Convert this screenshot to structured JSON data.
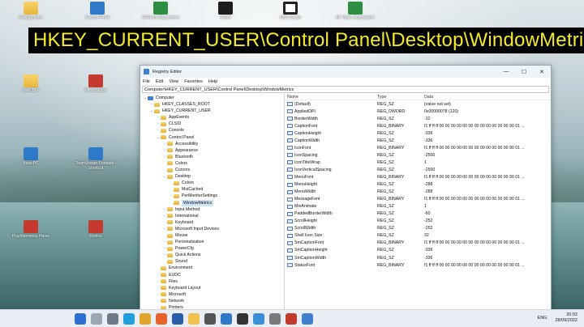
{
  "banner_text": "HKEY_CURRENT_USER\\Control Panel\\Desktop\\WindowMetrics",
  "desktop_icons": [
    {
      "label": "Desktop Icon",
      "glyph": "folder-glyph"
    },
    {
      "label": "Control Panel",
      "glyph": "app-glyph-blue"
    },
    {
      "label": "GeForce Experience",
      "glyph": "app-glyph-green"
    },
    {
      "label": "DS4S",
      "glyph": "app-glyph-dark"
    },
    {
      "label": "OBS Studio",
      "glyph": "app-glyph-round"
    },
    {
      "label": "4K Video Downloader",
      "glyph": "app-glyph-green"
    },
    {
      "label": "newCBFF",
      "glyph": "folder-glyph"
    },
    {
      "label": "PhotoScape",
      "glyph": "app-glyph-red"
    },
    {
      "label": "BasicPC",
      "glyph": "app-glyph-blue"
    },
    {
      "label": "TeamViewer Portable - Shortcut",
      "glyph": "app-glyph-blue"
    },
    {
      "label": "PlayMemories Home",
      "glyph": "app-glyph-red"
    },
    {
      "label": "Firefox",
      "glyph": "app-glyph-red"
    }
  ],
  "window": {
    "title": "Registry Editor",
    "buttons": {
      "minimize": "—",
      "maximize": "☐",
      "close": "✕"
    },
    "menu": [
      "File",
      "Edit",
      "View",
      "Favorites",
      "Help"
    ],
    "address": "Computer\\HKEY_CURRENT_USER\\Control Panel\\Desktop\\WindowMetrics"
  },
  "tree": [
    {
      "label": "Computer",
      "depth": 0,
      "arrow": "⌄",
      "icon": "pc"
    },
    {
      "label": "HKEY_CLASSES_ROOT",
      "depth": 1,
      "arrow": "›",
      "icon": "folder"
    },
    {
      "label": "HKEY_CURRENT_USER",
      "depth": 1,
      "arrow": "⌄",
      "icon": "folder"
    },
    {
      "label": "AppEvents",
      "depth": 2,
      "arrow": "›",
      "icon": "folder"
    },
    {
      "label": "CLSID",
      "depth": 2,
      "arrow": "›",
      "icon": "folder"
    },
    {
      "label": "Console",
      "depth": 2,
      "arrow": "›",
      "icon": "folder"
    },
    {
      "label": "Control Panel",
      "depth": 2,
      "arrow": "⌄",
      "icon": "folder"
    },
    {
      "label": "Accessibility",
      "depth": 3,
      "arrow": "›",
      "icon": "folder"
    },
    {
      "label": "Appearance",
      "depth": 3,
      "arrow": "›",
      "icon": "folder"
    },
    {
      "label": "Bluetooth",
      "depth": 3,
      "arrow": "›",
      "icon": "folder"
    },
    {
      "label": "Colors",
      "depth": 3,
      "arrow": "",
      "icon": "folder"
    },
    {
      "label": "Cursors",
      "depth": 3,
      "arrow": "",
      "icon": "folder"
    },
    {
      "label": "Desktop",
      "depth": 3,
      "arrow": "⌄",
      "icon": "folder"
    },
    {
      "label": "Colors",
      "depth": 4,
      "arrow": "",
      "icon": "folder"
    },
    {
      "label": "MuiCached",
      "depth": 4,
      "arrow": "",
      "icon": "folder"
    },
    {
      "label": "PerMonitorSettings",
      "depth": 4,
      "arrow": "›",
      "icon": "folder"
    },
    {
      "label": "WindowMetrics",
      "depth": 4,
      "arrow": "",
      "icon": "folder",
      "selected": true
    },
    {
      "label": "Input Method",
      "depth": 3,
      "arrow": "›",
      "icon": "folder"
    },
    {
      "label": "International",
      "depth": 3,
      "arrow": "›",
      "icon": "folder"
    },
    {
      "label": "Keyboard",
      "depth": 3,
      "arrow": "",
      "icon": "folder"
    },
    {
      "label": "Microsoft Input Devices",
      "depth": 3,
      "arrow": "›",
      "icon": "folder"
    },
    {
      "label": "Mouse",
      "depth": 3,
      "arrow": "",
      "icon": "folder"
    },
    {
      "label": "Personalization",
      "depth": 3,
      "arrow": "›",
      "icon": "folder"
    },
    {
      "label": "PowerCfg",
      "depth": 3,
      "arrow": "›",
      "icon": "folder"
    },
    {
      "label": "Quick Actions",
      "depth": 3,
      "arrow": "›",
      "icon": "folder"
    },
    {
      "label": "Sound",
      "depth": 3,
      "arrow": "",
      "icon": "folder"
    },
    {
      "label": "Environment",
      "depth": 2,
      "arrow": "",
      "icon": "folder"
    },
    {
      "label": "EUDC",
      "depth": 2,
      "arrow": "›",
      "icon": "folder"
    },
    {
      "label": "Files",
      "depth": 2,
      "arrow": "›",
      "icon": "folder"
    },
    {
      "label": "Keyboard Layout",
      "depth": 2,
      "arrow": "›",
      "icon": "folder"
    },
    {
      "label": "Microsoft",
      "depth": 2,
      "arrow": "›",
      "icon": "folder"
    },
    {
      "label": "Network",
      "depth": 2,
      "arrow": "›",
      "icon": "folder"
    },
    {
      "label": "Printers",
      "depth": 2,
      "arrow": "›",
      "icon": "folder"
    }
  ],
  "columns": {
    "name": "Name",
    "type": "Type",
    "data": "Data"
  },
  "values": [
    {
      "name": "(Default)",
      "type": "REG_SZ",
      "data": "(value not set)",
      "kind": "sz"
    },
    {
      "name": "AppliedDPI",
      "type": "REG_DWORD",
      "data": "0x00000078 (120)",
      "kind": "bin"
    },
    {
      "name": "BorderWidth",
      "type": "REG_SZ",
      "data": "-12",
      "kind": "sz"
    },
    {
      "name": "CaptionFont",
      "type": "REG_BINARY",
      "data": "f1 ff ff ff 00 00 00 00 00 00 00 00 00 00 00 00 90 01 ...",
      "kind": "bin"
    },
    {
      "name": "CaptionHeight",
      "type": "REG_SZ",
      "data": "-336",
      "kind": "sz"
    },
    {
      "name": "CaptionWidth",
      "type": "REG_SZ",
      "data": "-336",
      "kind": "sz"
    },
    {
      "name": "IconFont",
      "type": "REG_BINARY",
      "data": "f1 ff ff ff 00 00 00 00 00 00 00 00 00 00 00 00 90 01 ...",
      "kind": "bin"
    },
    {
      "name": "IconSpacing",
      "type": "REG_SZ",
      "data": "-2500",
      "kind": "sz"
    },
    {
      "name": "IconTitleWrap",
      "type": "REG_SZ",
      "data": "1",
      "kind": "sz"
    },
    {
      "name": "IconVerticalSpacing",
      "type": "REG_SZ",
      "data": "-2500",
      "kind": "sz"
    },
    {
      "name": "MenuFont",
      "type": "REG_BINARY",
      "data": "f1 ff ff ff 00 00 00 00 00 00 00 00 00 00 00 00 90 01 ...",
      "kind": "bin"
    },
    {
      "name": "MenuHeight",
      "type": "REG_SZ",
      "data": "-288",
      "kind": "sz"
    },
    {
      "name": "MenuWidth",
      "type": "REG_SZ",
      "data": "-288",
      "kind": "sz"
    },
    {
      "name": "MessageFont",
      "type": "REG_BINARY",
      "data": "f1 ff ff ff 00 00 00 00 00 00 00 00 00 00 00 00 90 01 ...",
      "kind": "bin"
    },
    {
      "name": "MinAnimate",
      "type": "REG_SZ",
      "data": "1",
      "kind": "sz"
    },
    {
      "name": "PaddedBorderWidth",
      "type": "REG_SZ",
      "data": "-60",
      "kind": "sz"
    },
    {
      "name": "ScrollHeight",
      "type": "REG_SZ",
      "data": "-252",
      "kind": "sz"
    },
    {
      "name": "ScrollWidth",
      "type": "REG_SZ",
      "data": "-252",
      "kind": "sz"
    },
    {
      "name": "Shell Icon Size",
      "type": "REG_SZ",
      "data": "32",
      "kind": "sz"
    },
    {
      "name": "SmCaptionFont",
      "type": "REG_BINARY",
      "data": "f1 ff ff ff 00 00 00 00 00 00 00 00 00 00 00 00 90 01 ...",
      "kind": "bin"
    },
    {
      "name": "SmCaptionHeight",
      "type": "REG_SZ",
      "data": "-336",
      "kind": "sz"
    },
    {
      "name": "SmCaptionWidth",
      "type": "REG_SZ",
      "data": "-336",
      "kind": "sz"
    },
    {
      "name": "StatusFont",
      "type": "REG_BINARY",
      "data": "f1 ff ff ff 00 00 00 00 00 00 00 00 00 00 00 00 90 01 ...",
      "kind": "bin"
    }
  ],
  "taskbar": {
    "apps": [
      "start-icon",
      "search-icon",
      "task-view-icon",
      "edge-icon",
      "chrome-icon",
      "firefox-icon",
      "word-icon",
      "file-explorer-icon",
      "store-icon",
      "mail-icon",
      "obs-icon",
      "photos-icon",
      "settings-icon",
      "media-icon",
      "registry-icon"
    ],
    "language": "ENG",
    "time": "20:02",
    "date": "28/09/2022"
  }
}
